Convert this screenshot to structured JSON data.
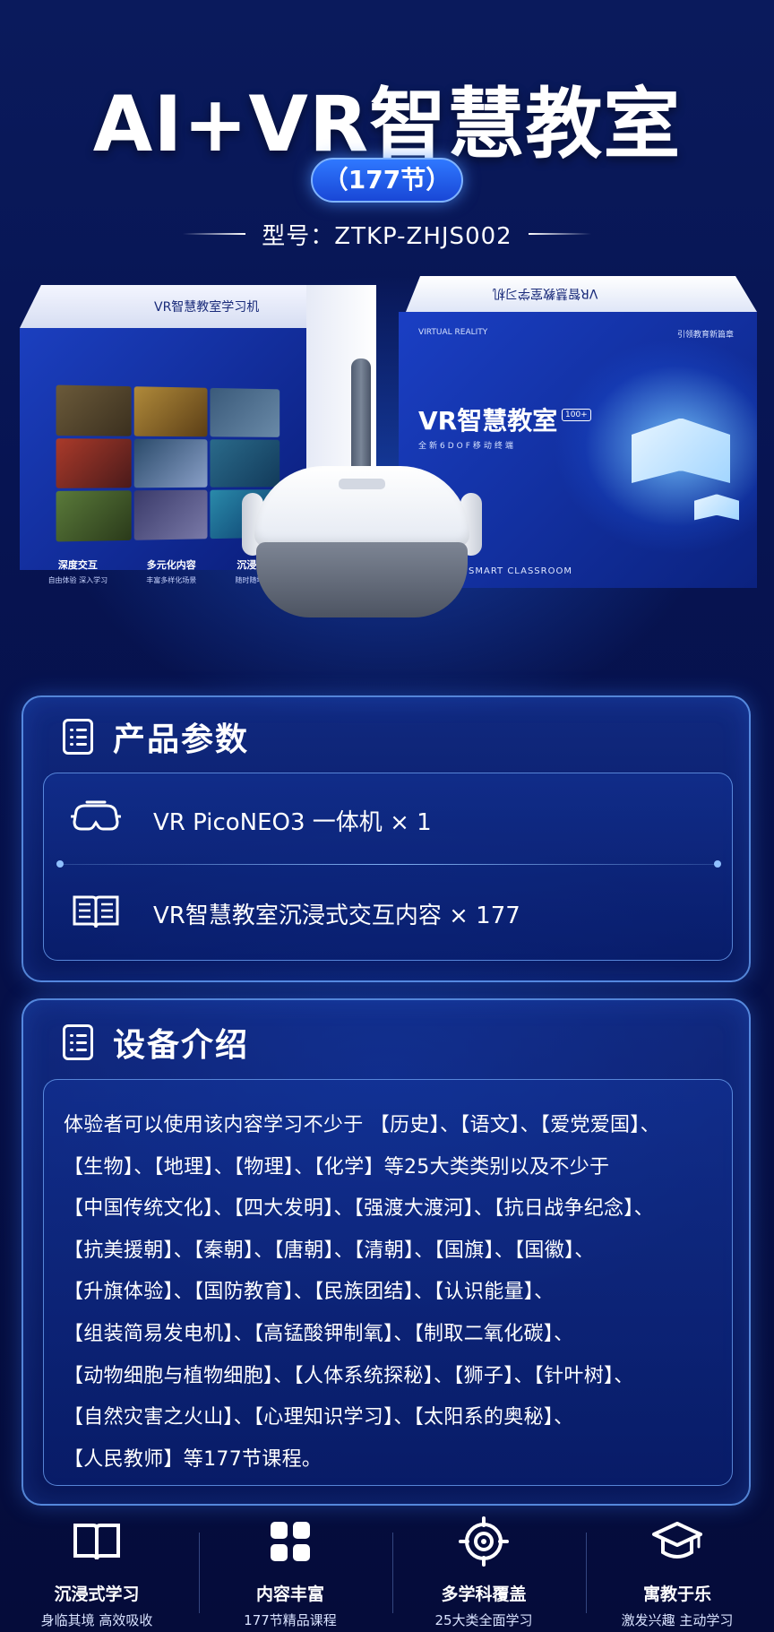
{
  "hero": {
    "title": "AI+VR智慧教室",
    "pill": "（177节）",
    "model": "型号：ZTKP-ZHJS002"
  },
  "box_left": {
    "top_text": "VR智慧教室学习机",
    "features": [
      {
        "title": "深度交互",
        "sub": "自由体验 深入学习"
      },
      {
        "title": "多元化内容",
        "sub": "丰富多样化场景"
      },
      {
        "title": "沉浸体验",
        "sub": "随时随地学习"
      }
    ]
  },
  "box_right": {
    "top_text": "VR智慧教室学习机",
    "vr_tag": "VIRTUAL REALITY",
    "lead_tag": "引领教育新篇章",
    "title": "VR智慧教室",
    "badge": "100+",
    "sub": "全新6DOF移动终端",
    "smart": "SMART CLASSROOM"
  },
  "params": {
    "title": "产品参数",
    "items": [
      {
        "icon": "vr-headset-icon",
        "text": "VR PicoNEO3 一体机 × 1"
      },
      {
        "icon": "book-icon",
        "text": "VR智慧教室沉浸式交互内容 × 177"
      }
    ]
  },
  "intro": {
    "title": "设备介绍",
    "lines": [
      "体验者可以使用该内容学习不少于 【历史】、【语文】、【爱党爱国】、",
      "【生物】、【地理】、【物理】、【化学】等25大类类别以及不少于",
      "【中国传统文化】、【四大发明】、【强渡大渡河】、【抗日战争纪念】、",
      "【抗美援朝】、【秦朝】、【唐朝】、【清朝】、【国旗】、【国徽】、",
      "【升旗体验】、【国防教育】、【民族团结】、【认识能量】、",
      "【组装简易发电机】、【高锰酸钾制氧】、【制取二氧化碳】、",
      "【动物细胞与植物细胞】、【人体系统探秘】、【狮子】、【针叶树】、",
      "【自然灾害之火山】、【心理知识学习】、【太阳系的奥秘】、",
      "【人民教师】等177节课程。"
    ]
  },
  "bottom_features": [
    {
      "icon": "open-book-icon",
      "title": "沉浸式学习",
      "sub": "身临其境 高效吸收"
    },
    {
      "icon": "grid-icon",
      "title": "内容丰富",
      "sub": "177节精品课程"
    },
    {
      "icon": "target-icon",
      "title": "多学科覆盖",
      "sub": "25大类全面学习"
    },
    {
      "icon": "graduation-cap-icon",
      "title": "寓教于乐",
      "sub": "激发兴趣 主动学习"
    }
  ],
  "colors": {
    "background": "#071452",
    "accent": "#2f78ff",
    "panel_border": "#6eaaff"
  }
}
